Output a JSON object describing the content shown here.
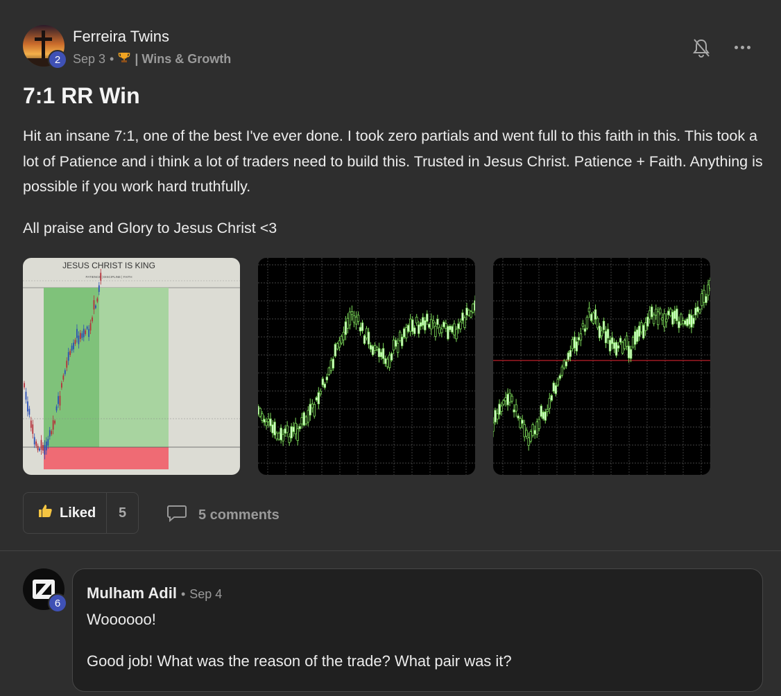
{
  "post": {
    "author": {
      "name": "Ferreira Twins",
      "level": "2",
      "avatar": "cross-sunset-avatar"
    },
    "date": "Sep 3",
    "separator": "•",
    "category_icon": "trophy-icon",
    "category": "| Wins & Growth",
    "title": "7:1 RR Win",
    "body": "Hit an insane 7:1, one of the best I've ever done. I took zero partials and went full to this faith in this. This took a lot of Patience and i think a lot of traders need to build this. Trusted in Jesus Christ. Patience + Faith. Anything is possible if you work hard truthfully.",
    "body2": "All praise and Glory to Jesus Christ <3",
    "attachments": [
      {
        "type": "trade-chart",
        "title": "JESUS CHRIST IS KING",
        "subtitle": "PATIENCE | DISCIPLINE | FAITH"
      },
      {
        "type": "candlestick-chart"
      },
      {
        "type": "candlestick-chart"
      }
    ],
    "like_label": "Liked",
    "like_count": "5",
    "comments_label": "5 comments",
    "header_icons": [
      "bell-muted-icon",
      "more-icon"
    ]
  },
  "comment": {
    "author": "Mulham Adil",
    "level": "6",
    "separator": "•",
    "date": "Sep 4",
    "line1": "Woooooo!",
    "line2": "Good job! What was the reason of the trade? What pair was it?"
  },
  "colors": {
    "background": "#2e2e2e",
    "badge": "#3f51b5",
    "comment_bg": "#202020",
    "like_icon": "#f5c542"
  }
}
